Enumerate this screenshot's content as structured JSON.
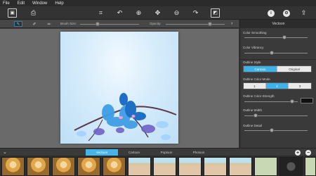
{
  "menu": [
    "File",
    "Edit",
    "Window",
    "Help"
  ],
  "toolbar": {
    "left_icons": [
      "gallery-icon",
      "export-icon"
    ],
    "center_icons": [
      "crop-icon",
      "undo-icon",
      "zoom-in-icon",
      "move-icon",
      "zoom-out-icon",
      "redo-icon",
      "compare-icon"
    ],
    "right_icons": [
      "info-icon",
      "settings-icon",
      "share-icon"
    ]
  },
  "brushbar": {
    "brush_size_label": "Brush Size:",
    "brush_size_value": 0.3,
    "opacity_label": "Opacity:",
    "opacity_value": 0.75,
    "tools": [
      "paint-brush-icon",
      "erase-brush-icon",
      "mask-brush-icon"
    ]
  },
  "panel": {
    "title": "Vectoon",
    "color_smoothing": {
      "label": "Color Smoothing",
      "value": 0.63
    },
    "color_vibrancy": {
      "label": "Color Vibrancy",
      "value": 0.43
    },
    "outline_style": {
      "label": "Outline Style",
      "options": [
        "Cartoon",
        "Original"
      ],
      "selected": "Cartoon"
    },
    "outline_color_mode": {
      "label": "Outline Color Mode",
      "options": [
        "1",
        "2",
        "3"
      ],
      "selected": "2"
    },
    "outline_color_strength": {
      "label": "Outline Color Strength",
      "value": 0.9,
      "swatch_color": "#111111"
    },
    "outline_width": {
      "label": "Outline Width",
      "value": 0.18
    },
    "outline_detail": {
      "label": "Outline Detail",
      "value": 0.43
    }
  },
  "styles": {
    "tabs": [
      "Vectoon",
      "Cartoon",
      "Poptoon",
      "Photoon"
    ],
    "active": "Vectoon"
  },
  "colors": {
    "accent": "#45b4e8",
    "panel_bg": "#3a3a3a",
    "canvas_bg": "#6a6a6a"
  }
}
